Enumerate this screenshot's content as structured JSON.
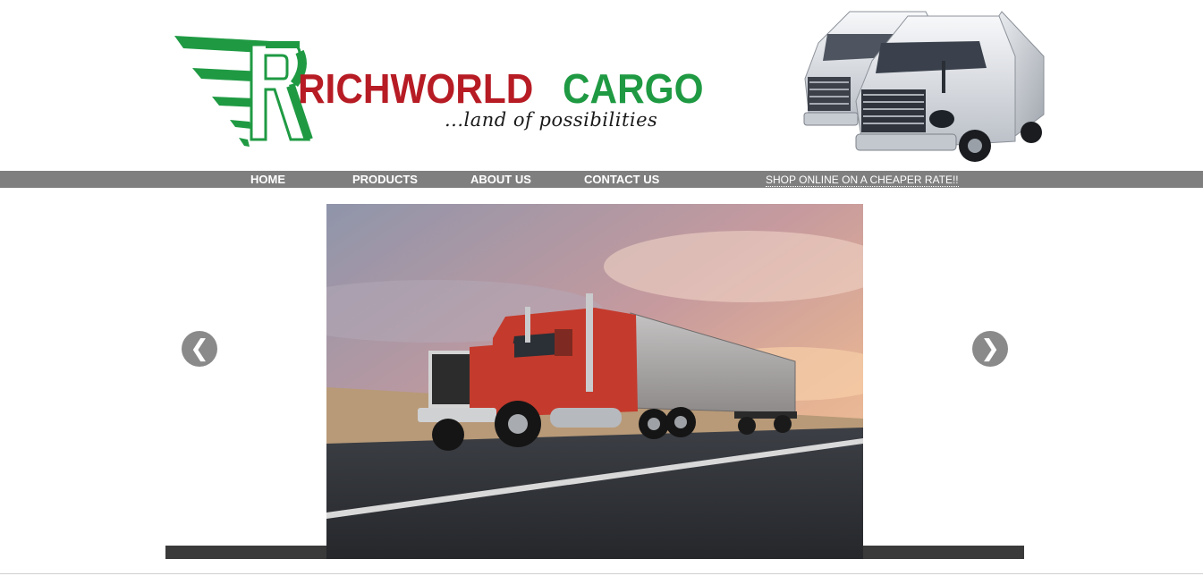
{
  "header": {
    "brand_first": "RICHWORLD",
    "brand_second": "CARGO",
    "tagline": "...land of possibilities"
  },
  "nav": {
    "items": [
      {
        "label": "HOME"
      },
      {
        "label": "PRODUCTS"
      },
      {
        "label": "ABOUT US"
      },
      {
        "label": "CONTACT US"
      }
    ],
    "promo": "SHOP ONLINE ON A CHEAPER RATE!!"
  },
  "slider": {
    "prev_symbol": "❮",
    "next_symbol": "❯"
  },
  "colors": {
    "brand_red": "#b71c25",
    "brand_green": "#1f9a43",
    "nav_bg": "#7f7f7f"
  }
}
